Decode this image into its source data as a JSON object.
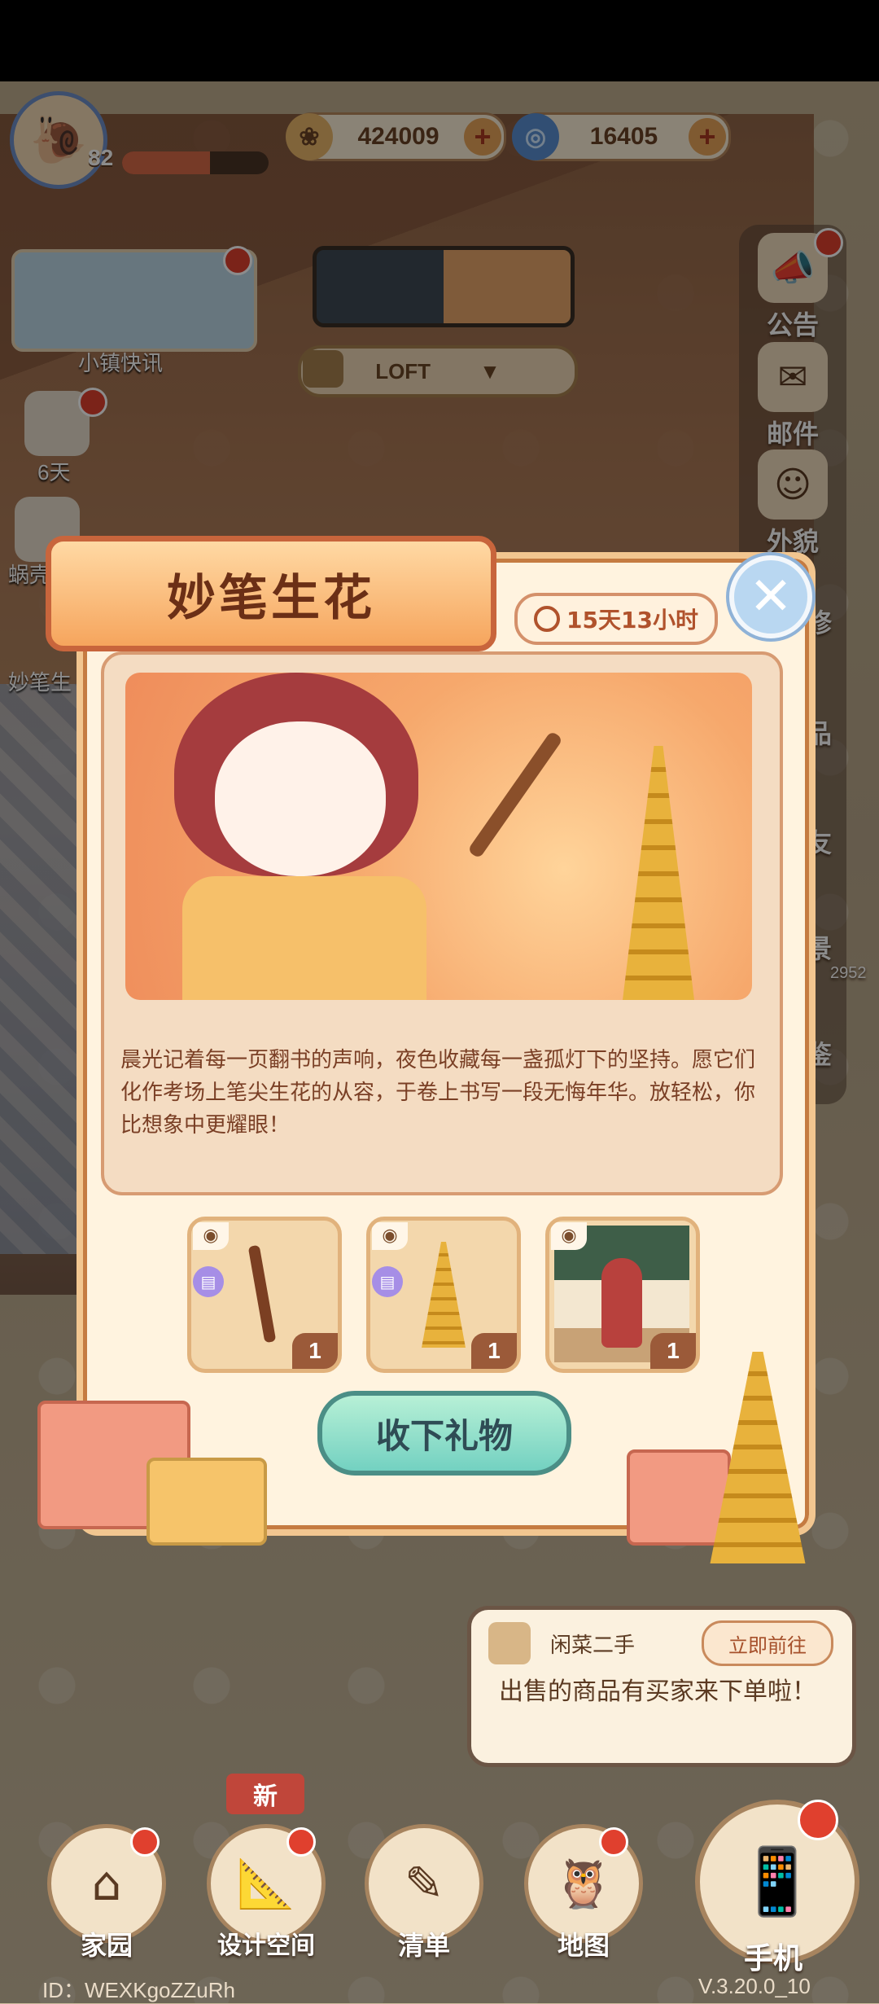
{
  "hud": {
    "level": "82",
    "exp_fraction": 0.6,
    "coins": "424009",
    "gems": "16405",
    "news_label": "小镇快讯",
    "room_selector": "LOFT",
    "left_labels": [
      "6天",
      "蜗壳",
      "妙笔生"
    ]
  },
  "right_rail": [
    {
      "label": "公告",
      "icon": "megaphone-icon"
    },
    {
      "label": "邮件",
      "icon": "envelope-icon"
    },
    {
      "label": "外貌",
      "icon": "face-icon"
    }
  ],
  "right_rail_partial": [
    "修",
    "品",
    "友",
    "景",
    "鉴"
  ],
  "right_rail_count": "2952",
  "modal": {
    "title": "妙笔生花",
    "timer": "15天13小时",
    "description": "晨光记着每一页翻书的声响，夜色收藏每一盏孤灯下的坚持。愿它们化作考场上笔尖生花的从容，于卷上书写一段无悔年华。放轻松，你比想象中更耀眼！",
    "rewards": [
      {
        "item": "brush",
        "count": "1"
      },
      {
        "item": "pagoda",
        "count": "1"
      },
      {
        "item": "scene",
        "count": "1"
      }
    ],
    "accept_button": "收下礼物"
  },
  "toast": {
    "title": "闲菜二手",
    "go_button": "立即前往",
    "message": "出售的商品有买家来下单啦！"
  },
  "bottom_nav": [
    {
      "label": "家园",
      "icon": "house-icon"
    },
    {
      "label": "设计空间",
      "icon": "ruler-icon"
    },
    {
      "label": "清单",
      "icon": "notebook-icon"
    },
    {
      "label": "地图",
      "icon": "owl-icon"
    }
  ],
  "new_badge": "新",
  "phone_label": "手机",
  "footer": {
    "id": "ID：WEXKgoZZuRh",
    "version": "V.3.20.0_10"
  }
}
